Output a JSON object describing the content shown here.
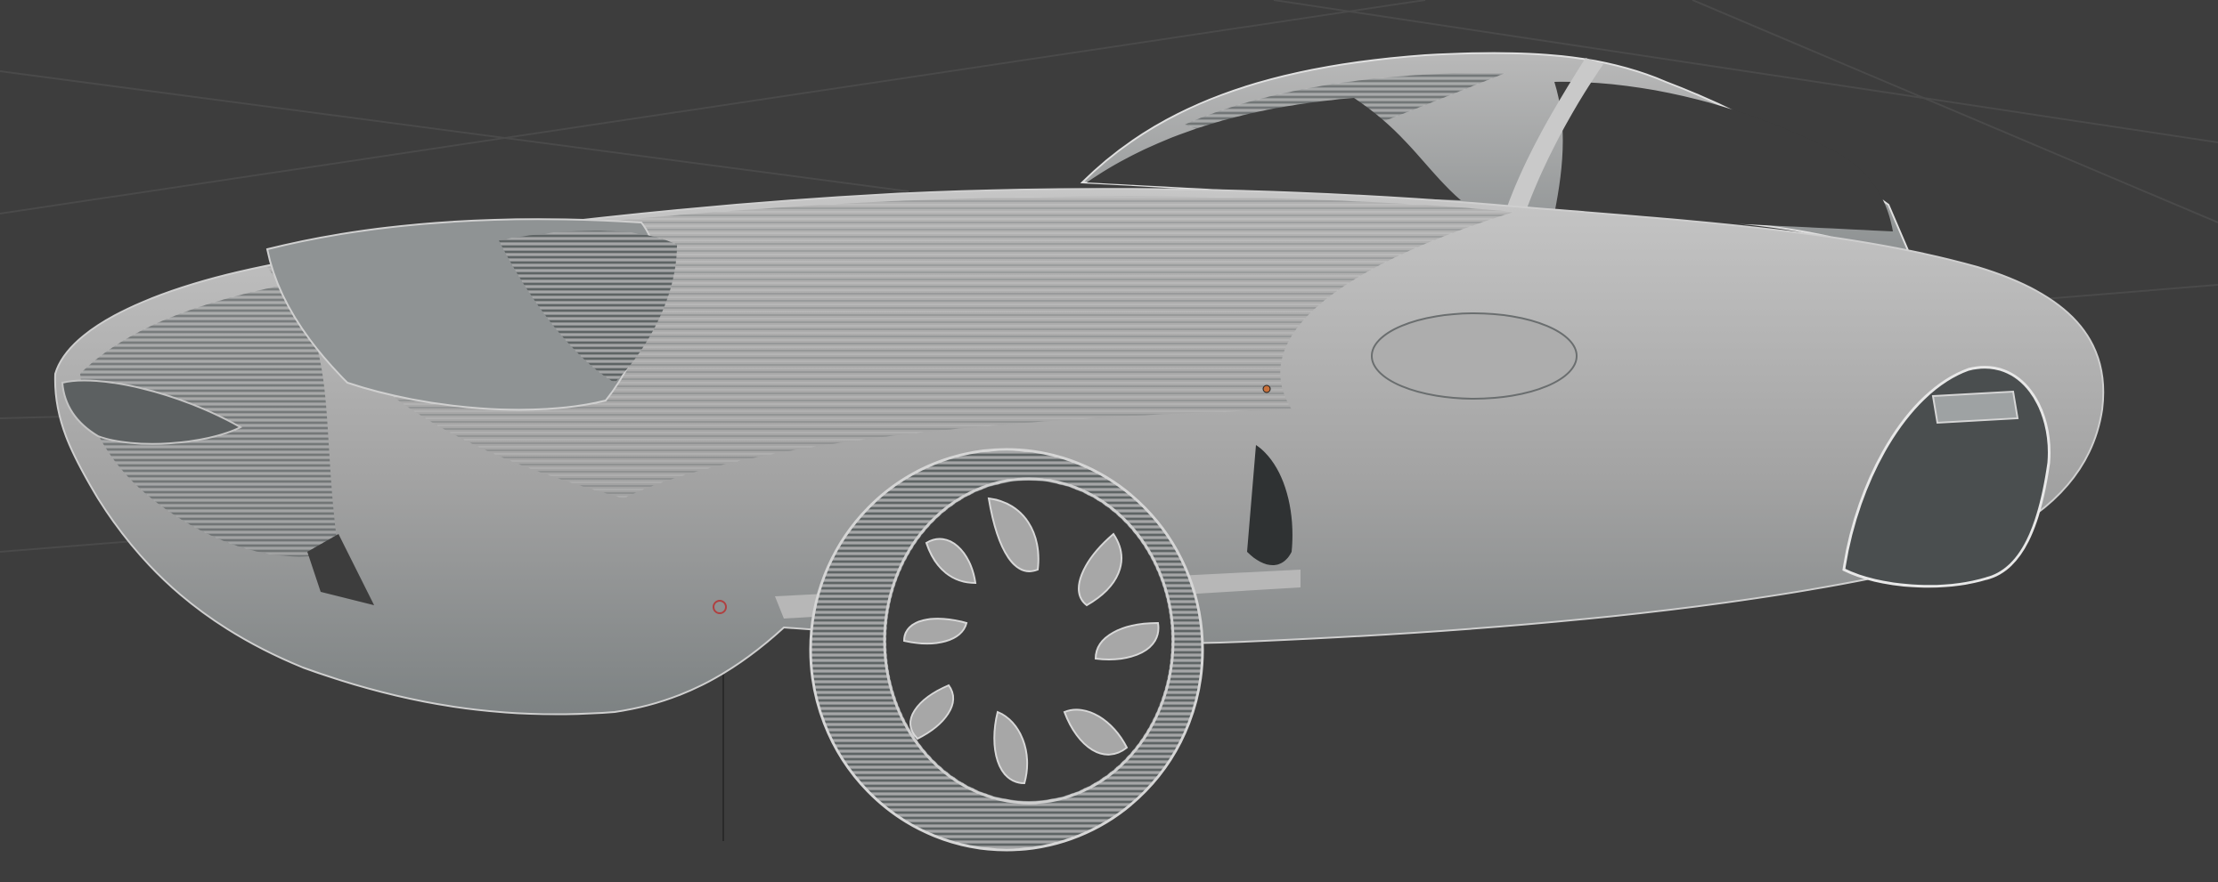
{
  "viewport": {
    "background": "#3d3d3d",
    "grid_color": "#4a4a4a",
    "model": {
      "name_icon": "car-model-icon",
      "base_color": "#a9a9a9",
      "shadow_color": "#5f6566",
      "highlight_color": "#d2d2d2",
      "contour_color": "#2e3233"
    },
    "origin_marker_color": "#c8703a",
    "cursor_color": "#b04040"
  }
}
